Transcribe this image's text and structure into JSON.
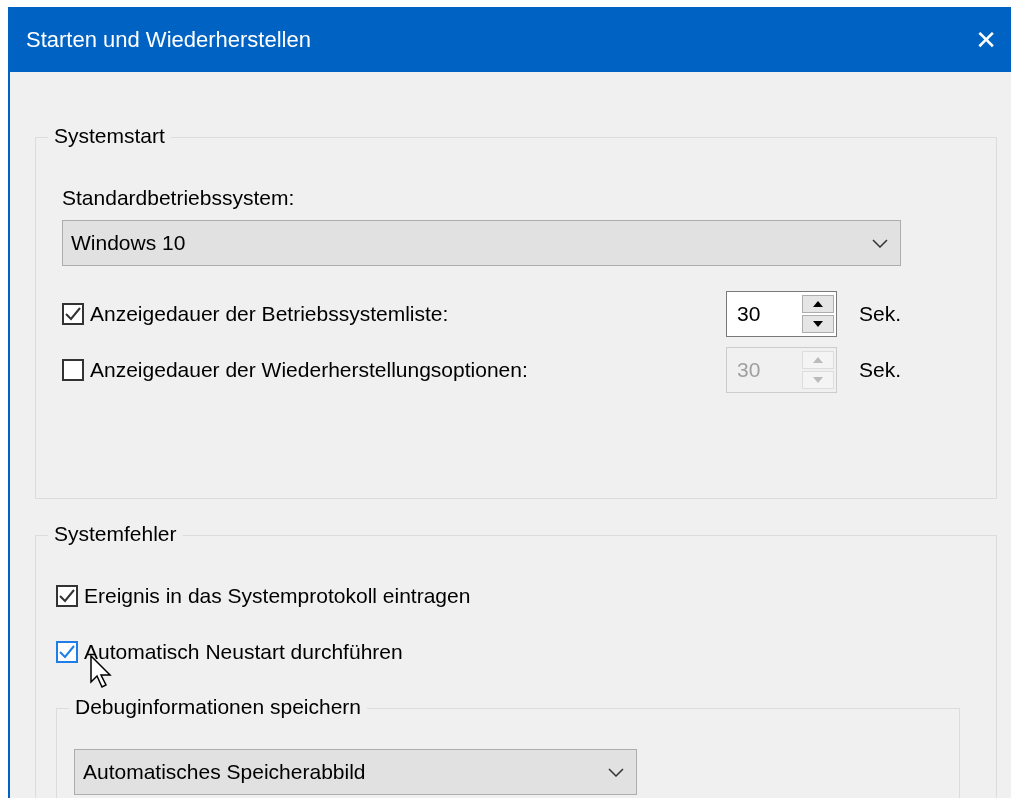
{
  "window": {
    "title": "Starten und Wiederherstellen",
    "close": "✕"
  },
  "systemstart": {
    "legend": "Systemstart",
    "default_os": {
      "label": "Standardbetriebssystem:",
      "value": "Windows 10"
    },
    "timeouts": [
      {
        "label": "Anzeigedauer der Betriebssystemliste:",
        "checked": true,
        "value": "30",
        "disabled": false,
        "unit": "Sek."
      },
      {
        "label": "Anzeigedauer der Wiederherstellungsoptionen:",
        "checked": false,
        "value": "30",
        "disabled": true,
        "unit": "Sek."
      }
    ]
  },
  "systemfehler": {
    "legend": "Systemfehler",
    "options": [
      {
        "label": "Ereignis in das Systemprotokoll eintragen",
        "checked": true,
        "hovered": false
      },
      {
        "label": "Automatisch Neustart durchführen",
        "checked": true,
        "hovered": true
      }
    ],
    "debug": {
      "legend": "Debuginformationen speichern",
      "value": "Automatisches Speicherabbild"
    }
  }
}
